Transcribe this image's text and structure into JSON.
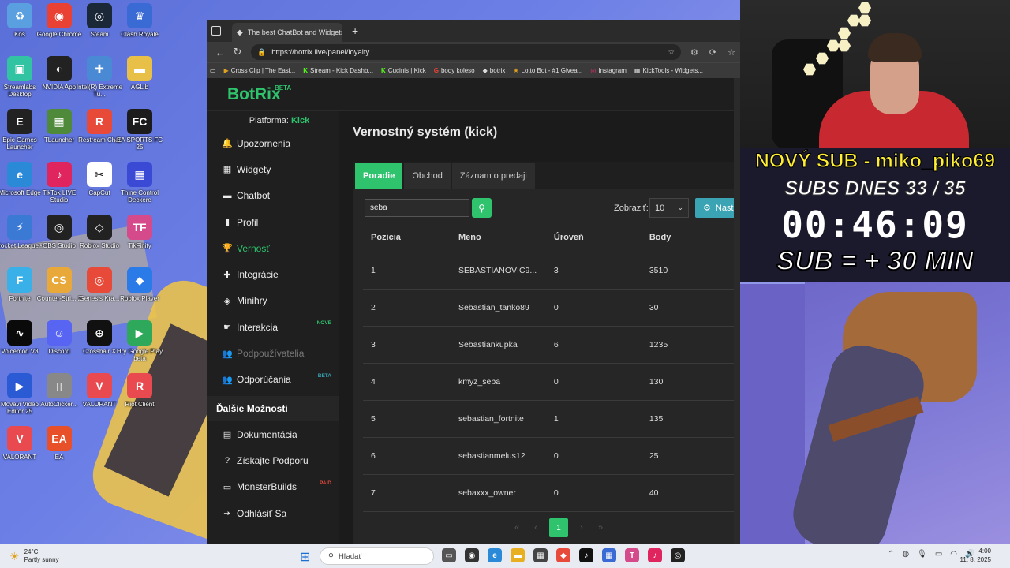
{
  "desktop": {
    "icons": [
      {
        "label": "Kôš",
        "icon": "recycle-bin-icon",
        "color": "#5aa0e0",
        "glyph": "♻"
      },
      {
        "label": "Google Chrome",
        "icon": "chrome-icon",
        "color": "#e94235",
        "glyph": "◉"
      },
      {
        "label": "Steam",
        "icon": "steam-icon",
        "color": "#1b2838",
        "glyph": "◎"
      },
      {
        "label": "Clash Royale",
        "icon": "clash-royale-icon",
        "color": "#3a6ad4",
        "glyph": "♛"
      },
      {
        "label": "Streamlabs Desktop",
        "icon": "streamlabs-icon",
        "color": "#31c3a2",
        "glyph": "▣"
      },
      {
        "label": "NVIDIA App",
        "icon": "nvidia-icon",
        "color": "#222",
        "glyph": "◐"
      },
      {
        "label": "Intel(R) Extreme Tu...",
        "icon": "intel-icon",
        "color": "#4a8ad4",
        "glyph": "✚"
      },
      {
        "label": "AGLib",
        "icon": "folder-icon",
        "color": "#e8c048",
        "glyph": "▬"
      },
      {
        "label": "Epic Games Launcher",
        "icon": "epic-games-icon",
        "color": "#222",
        "glyph": "E"
      },
      {
        "label": "TLauncher",
        "icon": "tlauncher-icon",
        "color": "#4f8a3a",
        "glyph": "▦"
      },
      {
        "label": "Restream Chat",
        "icon": "restream-icon",
        "color": "#e84a3a",
        "glyph": "R"
      },
      {
        "label": "EA SPORTS FC 25",
        "icon": "fc25-icon",
        "color": "#1c1c1c",
        "glyph": "FC"
      },
      {
        "label": "Microsoft Edge",
        "icon": "edge-icon",
        "color": "#2a8ad8",
        "glyph": "e"
      },
      {
        "label": "TikTok LIVE Studio",
        "icon": "tiktok-live-icon",
        "color": "#e0245e",
        "glyph": "♪"
      },
      {
        "label": "CapCut",
        "icon": "capcut-icon",
        "color": "#fff",
        "glyph": "✂"
      },
      {
        "label": "Thine Control Deckere",
        "icon": "deck-icon",
        "color": "#3a4ad4",
        "glyph": "▦"
      },
      {
        "label": "Rocket League®",
        "icon": "rocket-league-icon",
        "color": "#3a7ad4",
        "glyph": "⚡"
      },
      {
        "label": "OBS Studio",
        "icon": "obs-icon",
        "color": "#222",
        "glyph": "◎"
      },
      {
        "label": "Roblox Studio",
        "icon": "roblox-studio-icon",
        "color": "#222",
        "glyph": "◇"
      },
      {
        "label": "TikFinity",
        "icon": "tikfinity-icon",
        "color": "#d44a8a",
        "glyph": "TF"
      },
      {
        "label": "Fortnite",
        "icon": "fortnite-icon",
        "color": "#3ab0e8",
        "glyph": "F"
      },
      {
        "label": "Counter-Stri... 2",
        "icon": "counter-strike-icon",
        "color": "#e8a83a",
        "glyph": "CS"
      },
      {
        "label": "Genesis Kra...",
        "icon": "genesis-icon",
        "color": "#e84a3a",
        "glyph": "◎"
      },
      {
        "label": "Roblox Player",
        "icon": "roblox-icon",
        "color": "#2a7ae8",
        "glyph": "◆"
      },
      {
        "label": "Voicemod V3",
        "icon": "voicemod-icon",
        "color": "#0a0a0a",
        "glyph": "∿"
      },
      {
        "label": "Discord",
        "icon": "discord-icon",
        "color": "#5865f2",
        "glyph": "☺"
      },
      {
        "label": "Crosshair X",
        "icon": "crosshair-icon",
        "color": "#111",
        "glyph": "⊕"
      },
      {
        "label": "Hry Google Play beta",
        "icon": "google-play-icon",
        "color": "#2ea85a",
        "glyph": "▶"
      },
      {
        "label": "Movavi Video Editor 25",
        "icon": "movavi-icon",
        "color": "#2a5ad4",
        "glyph": "▶"
      },
      {
        "label": "AutoClicker...",
        "icon": "mouse-icon",
        "color": "#888",
        "glyph": "▯"
      },
      {
        "label": "VALORANT",
        "icon": "valorant-icon",
        "color": "#e84a50",
        "glyph": "V"
      },
      {
        "label": "Riot Client",
        "icon": "riot-client-icon",
        "color": "#e84a50",
        "glyph": "R"
      },
      {
        "label": "VALORANT",
        "icon": "valorant-icon",
        "color": "#e84a50",
        "glyph": "V"
      },
      {
        "label": "EA",
        "icon": "ea-icon",
        "color": "#e8502a",
        "glyph": "EA"
      }
    ]
  },
  "browser": {
    "tab_title": "The best ChatBot and Widgets fo",
    "url": "https://botrix.live/panel/loyalty",
    "bookmarks": [
      {
        "label": "Cross Clip | The Easi...",
        "icon": "crossclip-icon",
        "color": "#e0a020",
        "glyph": "▶"
      },
      {
        "label": "Stream - Kick Dashb...",
        "icon": "kick-icon",
        "color": "#53fc18",
        "glyph": "K"
      },
      {
        "label": "Cucinis | Kick",
        "icon": "kick-icon",
        "color": "#53fc18",
        "glyph": "K"
      },
      {
        "label": "body koleso",
        "icon": "google-icon",
        "color": "#ea4335",
        "glyph": "G"
      },
      {
        "label": "botrix",
        "icon": "botrix-icon",
        "color": "#ddd",
        "glyph": "◆"
      },
      {
        "label": "Lotto Bot - #1 Givea...",
        "icon": "lottobot-icon",
        "color": "#e0a020",
        "glyph": "★"
      },
      {
        "label": "Instagram",
        "icon": "instagram-icon",
        "color": "#e1306c",
        "glyph": "◎"
      },
      {
        "label": "KickTools - Widgets...",
        "icon": "kicktools-icon",
        "color": "#ddd",
        "glyph": "▦"
      }
    ]
  },
  "app": {
    "brand": "BotRix",
    "brand_badge": "BETA",
    "platform_label": "Platforma:",
    "platform_value": "Kick",
    "nav": [
      {
        "label": "Upozornenia",
        "icon": "bell-icon",
        "glyph": "🔔",
        "state": "normal",
        "badge": ""
      },
      {
        "label": "Widgety",
        "icon": "grid-icon",
        "glyph": "▦",
        "state": "normal",
        "badge": ""
      },
      {
        "label": "Chatbot",
        "icon": "chat-icon",
        "glyph": "▬",
        "state": "normal",
        "badge": ""
      },
      {
        "label": "Profil",
        "icon": "profile-icon",
        "glyph": "▮",
        "state": "normal",
        "badge": ""
      },
      {
        "label": "Vernosť",
        "icon": "trophy-icon",
        "glyph": "🏆",
        "state": "active",
        "badge": ""
      },
      {
        "label": "Integrácie",
        "icon": "puzzle-icon",
        "glyph": "✚",
        "state": "normal",
        "badge": ""
      },
      {
        "label": "Minihry",
        "icon": "gamepad-icon",
        "glyph": "◈",
        "state": "normal",
        "badge": ""
      },
      {
        "label": "Interakcia",
        "icon": "pointer-icon",
        "glyph": "☛",
        "state": "normal",
        "badge": "NOVÉ"
      },
      {
        "label": "Podpoužívatelia",
        "icon": "users-icon",
        "glyph": "👥",
        "state": "disabled",
        "badge": ""
      },
      {
        "label": "Odporúčania",
        "icon": "referral-icon",
        "glyph": "👥",
        "state": "normal",
        "badge": "BETA"
      }
    ],
    "more_heading": "Ďalšie Možnosti",
    "more_nav": [
      {
        "label": "Dokumentácia",
        "icon": "book-icon",
        "glyph": "▤",
        "badge": ""
      },
      {
        "label": "Získajte Podporu",
        "icon": "help-icon",
        "glyph": "?",
        "badge": ""
      },
      {
        "label": "MonsterBuilds",
        "icon": "laptop-icon",
        "glyph": "▭",
        "badge": "PAID"
      },
      {
        "label": "Odhlásiť Sa",
        "icon": "logout-icon",
        "glyph": "⇥",
        "badge": ""
      }
    ],
    "page_title": "Vernostný systém (kick)",
    "tabs": [
      {
        "label": "Poradie",
        "active": true
      },
      {
        "label": "Obchod",
        "active": false
      },
      {
        "label": "Záznam o predaji",
        "active": false
      }
    ],
    "search_value": "seba",
    "show_label": "Zobraziť:",
    "show_value": "10",
    "settings_label": "Nasta",
    "table": {
      "headers": [
        "Pozícia",
        "Meno",
        "Úroveň",
        "Body"
      ],
      "rows": [
        [
          "1",
          "SEBASTIANOVIC9...",
          "3",
          "3510"
        ],
        [
          "2",
          "Sebastian_tanko89",
          "0",
          "30"
        ],
        [
          "3",
          "Sebastiankupka",
          "6",
          "1235"
        ],
        [
          "4",
          "kmyz_seba",
          "0",
          "130"
        ],
        [
          "5",
          "sebastian_fortnite",
          "1",
          "135"
        ],
        [
          "6",
          "sebastianmelus12",
          "0",
          "25"
        ],
        [
          "7",
          "sebaxxx_owner",
          "0",
          "40"
        ]
      ]
    },
    "pagination": {
      "first": "«",
      "prev": "‹",
      "current": "1",
      "next": "›",
      "last": "»"
    }
  },
  "stream": {
    "new_sub": "NOVÝ SUB - miko_piko69",
    "subs_today": "SUBS DNES  33 / 35",
    "timer": "00:46:09",
    "sub_rule": "SUB = + 30 MIN"
  },
  "taskbar": {
    "temp": "24°C",
    "weather": "Partly sunny",
    "search_placeholder": "Hľadať",
    "time": "4:00",
    "date": "11. 8. 2025",
    "apps": [
      {
        "icon": "task-view-icon",
        "color": "#555",
        "glyph": "▭"
      },
      {
        "icon": "app-icon",
        "color": "#333",
        "glyph": "◉"
      },
      {
        "icon": "edge-icon",
        "color": "#2a8ad8",
        "glyph": "e"
      },
      {
        "icon": "file-explorer-icon",
        "color": "#e8b020",
        "glyph": "▬"
      },
      {
        "icon": "store-icon",
        "color": "#444",
        "glyph": "▦"
      },
      {
        "icon": "app-red-icon",
        "color": "#e84a3a",
        "glyph": "◆"
      },
      {
        "icon": "tiktok-icon",
        "color": "#111",
        "glyph": "♪"
      },
      {
        "icon": "app-blue-icon",
        "color": "#3a6ad4",
        "glyph": "▦"
      },
      {
        "icon": "tikfinity-icon",
        "color": "#d44a8a",
        "glyph": "T"
      },
      {
        "icon": "tiktok-live-icon",
        "color": "#e0245e",
        "glyph": "♪"
      },
      {
        "icon": "obs-icon",
        "color": "#222",
        "glyph": "◎"
      }
    ]
  }
}
